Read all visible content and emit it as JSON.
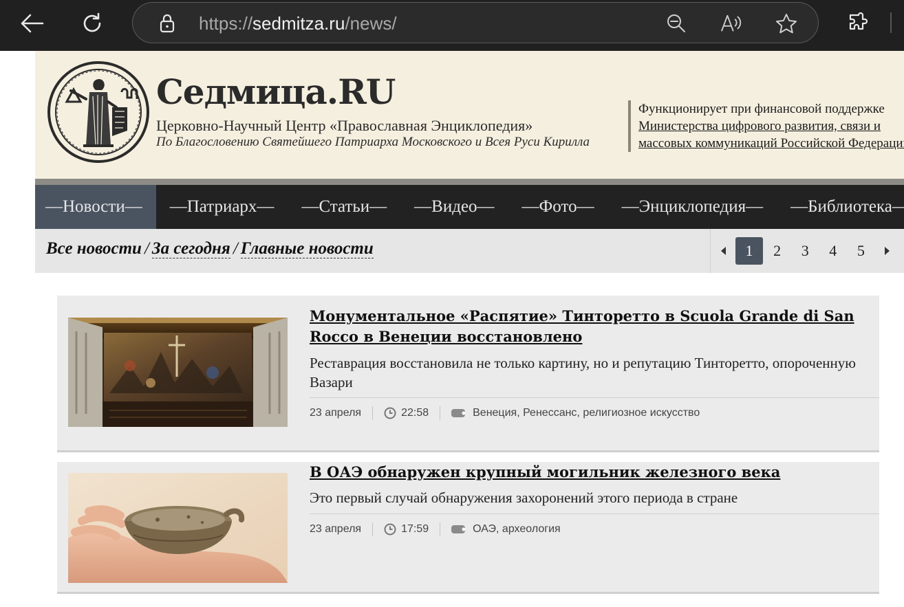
{
  "browser": {
    "url_prefix": "https://",
    "url_domain": "sedmitza.ru",
    "url_path": "/news/",
    "icons": [
      "back-icon",
      "reload-icon",
      "lock-icon",
      "zoom-out-icon",
      "read-aloud-icon",
      "favorite-star-icon",
      "extensions-icon"
    ]
  },
  "header": {
    "site_title": "Седмица.RU",
    "subtitle": "Церковно-Научный Центр «Православная Энциклопедия»",
    "blessing": "По Благословению Святейшего Патриарха Московского и Всея Руси Кирилла",
    "funding_text": "Функционирует при финансовой поддержке",
    "funding_link": "Министерства цифрового развития, связи и массовых коммуникаций Российской Федерации"
  },
  "menu": {
    "items": [
      {
        "label": "—Новости—",
        "active": true
      },
      {
        "label": "—Патриарх—",
        "active": false
      },
      {
        "label": "—Статьи—",
        "active": false
      },
      {
        "label": "—Видео—",
        "active": false
      },
      {
        "label": "—Фото—",
        "active": false
      },
      {
        "label": "—Энциклопедия—",
        "active": false
      },
      {
        "label": "—Библиотека—",
        "active": false
      }
    ]
  },
  "filter": {
    "all_news": "Все новости",
    "separator": "/",
    "today": "За сегодня",
    "main_news": "Главные новости"
  },
  "pager": {
    "pages": [
      "1",
      "2",
      "3",
      "4",
      "5"
    ],
    "current": "1"
  },
  "news": [
    {
      "title": "Монументальное «Распятие» Тинторетто в Scuola Grande di San Rocco в Венеции восстановлено",
      "lead": "Реставрация восстановила не только картину, но и репутацию Тинторетто, опороченную Вазари",
      "date": "23 апреля",
      "time": "22:58",
      "tags": "Венеция, Ренессанс, религиозное искусство"
    },
    {
      "title": "В ОАЭ обнаружен крупный могильник железного века",
      "lead": "Это первый случай обнаружения захоронений этого периода в стране",
      "date": "23 апреля",
      "time": "17:59",
      "tags": "ОАЭ, археология"
    }
  ],
  "colors": {
    "header_bg": "#f5efdf",
    "menu_bg": "#222222",
    "menu_active": "#4a5360",
    "news_bg": "#ebebeb"
  }
}
